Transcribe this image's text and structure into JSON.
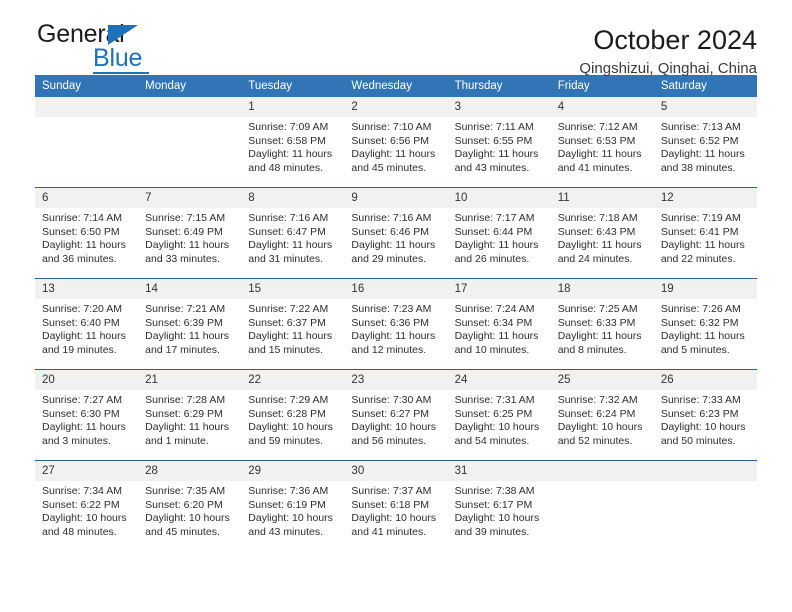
{
  "brand": {
    "name_top": "General",
    "name_bottom": "Blue",
    "accent_color": "#1f71b8"
  },
  "header": {
    "title": "October 2024",
    "subtitle": "Qingshizui, Qinghai, China"
  },
  "calendar": {
    "header_bg": "#3275b6",
    "daynum_bg": "#f1f1f1",
    "separator_color": "#2a6099",
    "weekday_names": [
      "Sunday",
      "Monday",
      "Tuesday",
      "Wednesday",
      "Thursday",
      "Friday",
      "Saturday"
    ],
    "weeks": [
      [
        {
          "day": "",
          "blank": true
        },
        {
          "day": "",
          "blank": true
        },
        {
          "day": "1",
          "sunrise": "Sunrise: 7:09 AM",
          "sunset": "Sunset: 6:58 PM",
          "daylight": "Daylight: 11 hours and 48 minutes."
        },
        {
          "day": "2",
          "sunrise": "Sunrise: 7:10 AM",
          "sunset": "Sunset: 6:56 PM",
          "daylight": "Daylight: 11 hours and 45 minutes."
        },
        {
          "day": "3",
          "sunrise": "Sunrise: 7:11 AM",
          "sunset": "Sunset: 6:55 PM",
          "daylight": "Daylight: 11 hours and 43 minutes."
        },
        {
          "day": "4",
          "sunrise": "Sunrise: 7:12 AM",
          "sunset": "Sunset: 6:53 PM",
          "daylight": "Daylight: 11 hours and 41 minutes."
        },
        {
          "day": "5",
          "sunrise": "Sunrise: 7:13 AM",
          "sunset": "Sunset: 6:52 PM",
          "daylight": "Daylight: 11 hours and 38 minutes."
        }
      ],
      [
        {
          "day": "6",
          "sunrise": "Sunrise: 7:14 AM",
          "sunset": "Sunset: 6:50 PM",
          "daylight": "Daylight: 11 hours and 36 minutes."
        },
        {
          "day": "7",
          "sunrise": "Sunrise: 7:15 AM",
          "sunset": "Sunset: 6:49 PM",
          "daylight": "Daylight: 11 hours and 33 minutes."
        },
        {
          "day": "8",
          "sunrise": "Sunrise: 7:16 AM",
          "sunset": "Sunset: 6:47 PM",
          "daylight": "Daylight: 11 hours and 31 minutes."
        },
        {
          "day": "9",
          "sunrise": "Sunrise: 7:16 AM",
          "sunset": "Sunset: 6:46 PM",
          "daylight": "Daylight: 11 hours and 29 minutes."
        },
        {
          "day": "10",
          "sunrise": "Sunrise: 7:17 AM",
          "sunset": "Sunset: 6:44 PM",
          "daylight": "Daylight: 11 hours and 26 minutes."
        },
        {
          "day": "11",
          "sunrise": "Sunrise: 7:18 AM",
          "sunset": "Sunset: 6:43 PM",
          "daylight": "Daylight: 11 hours and 24 minutes."
        },
        {
          "day": "12",
          "sunrise": "Sunrise: 7:19 AM",
          "sunset": "Sunset: 6:41 PM",
          "daylight": "Daylight: 11 hours and 22 minutes."
        }
      ],
      [
        {
          "day": "13",
          "sunrise": "Sunrise: 7:20 AM",
          "sunset": "Sunset: 6:40 PM",
          "daylight": "Daylight: 11 hours and 19 minutes."
        },
        {
          "day": "14",
          "sunrise": "Sunrise: 7:21 AM",
          "sunset": "Sunset: 6:39 PM",
          "daylight": "Daylight: 11 hours and 17 minutes."
        },
        {
          "day": "15",
          "sunrise": "Sunrise: 7:22 AM",
          "sunset": "Sunset: 6:37 PM",
          "daylight": "Daylight: 11 hours and 15 minutes."
        },
        {
          "day": "16",
          "sunrise": "Sunrise: 7:23 AM",
          "sunset": "Sunset: 6:36 PM",
          "daylight": "Daylight: 11 hours and 12 minutes."
        },
        {
          "day": "17",
          "sunrise": "Sunrise: 7:24 AM",
          "sunset": "Sunset: 6:34 PM",
          "daylight": "Daylight: 11 hours and 10 minutes."
        },
        {
          "day": "18",
          "sunrise": "Sunrise: 7:25 AM",
          "sunset": "Sunset: 6:33 PM",
          "daylight": "Daylight: 11 hours and 8 minutes."
        },
        {
          "day": "19",
          "sunrise": "Sunrise: 7:26 AM",
          "sunset": "Sunset: 6:32 PM",
          "daylight": "Daylight: 11 hours and 5 minutes."
        }
      ],
      [
        {
          "day": "20",
          "sunrise": "Sunrise: 7:27 AM",
          "sunset": "Sunset: 6:30 PM",
          "daylight": "Daylight: 11 hours and 3 minutes."
        },
        {
          "day": "21",
          "sunrise": "Sunrise: 7:28 AM",
          "sunset": "Sunset: 6:29 PM",
          "daylight": "Daylight: 11 hours and 1 minute."
        },
        {
          "day": "22",
          "sunrise": "Sunrise: 7:29 AM",
          "sunset": "Sunset: 6:28 PM",
          "daylight": "Daylight: 10 hours and 59 minutes."
        },
        {
          "day": "23",
          "sunrise": "Sunrise: 7:30 AM",
          "sunset": "Sunset: 6:27 PM",
          "daylight": "Daylight: 10 hours and 56 minutes."
        },
        {
          "day": "24",
          "sunrise": "Sunrise: 7:31 AM",
          "sunset": "Sunset: 6:25 PM",
          "daylight": "Daylight: 10 hours and 54 minutes."
        },
        {
          "day": "25",
          "sunrise": "Sunrise: 7:32 AM",
          "sunset": "Sunset: 6:24 PM",
          "daylight": "Daylight: 10 hours and 52 minutes."
        },
        {
          "day": "26",
          "sunrise": "Sunrise: 7:33 AM",
          "sunset": "Sunset: 6:23 PM",
          "daylight": "Daylight: 10 hours and 50 minutes."
        }
      ],
      [
        {
          "day": "27",
          "sunrise": "Sunrise: 7:34 AM",
          "sunset": "Sunset: 6:22 PM",
          "daylight": "Daylight: 10 hours and 48 minutes."
        },
        {
          "day": "28",
          "sunrise": "Sunrise: 7:35 AM",
          "sunset": "Sunset: 6:20 PM",
          "daylight": "Daylight: 10 hours and 45 minutes."
        },
        {
          "day": "29",
          "sunrise": "Sunrise: 7:36 AM",
          "sunset": "Sunset: 6:19 PM",
          "daylight": "Daylight: 10 hours and 43 minutes."
        },
        {
          "day": "30",
          "sunrise": "Sunrise: 7:37 AM",
          "sunset": "Sunset: 6:18 PM",
          "daylight": "Daylight: 10 hours and 41 minutes."
        },
        {
          "day": "31",
          "sunrise": "Sunrise: 7:38 AM",
          "sunset": "Sunset: 6:17 PM",
          "daylight": "Daylight: 10 hours and 39 minutes."
        },
        {
          "day": "",
          "blank": true
        },
        {
          "day": "",
          "blank": true
        }
      ]
    ]
  }
}
